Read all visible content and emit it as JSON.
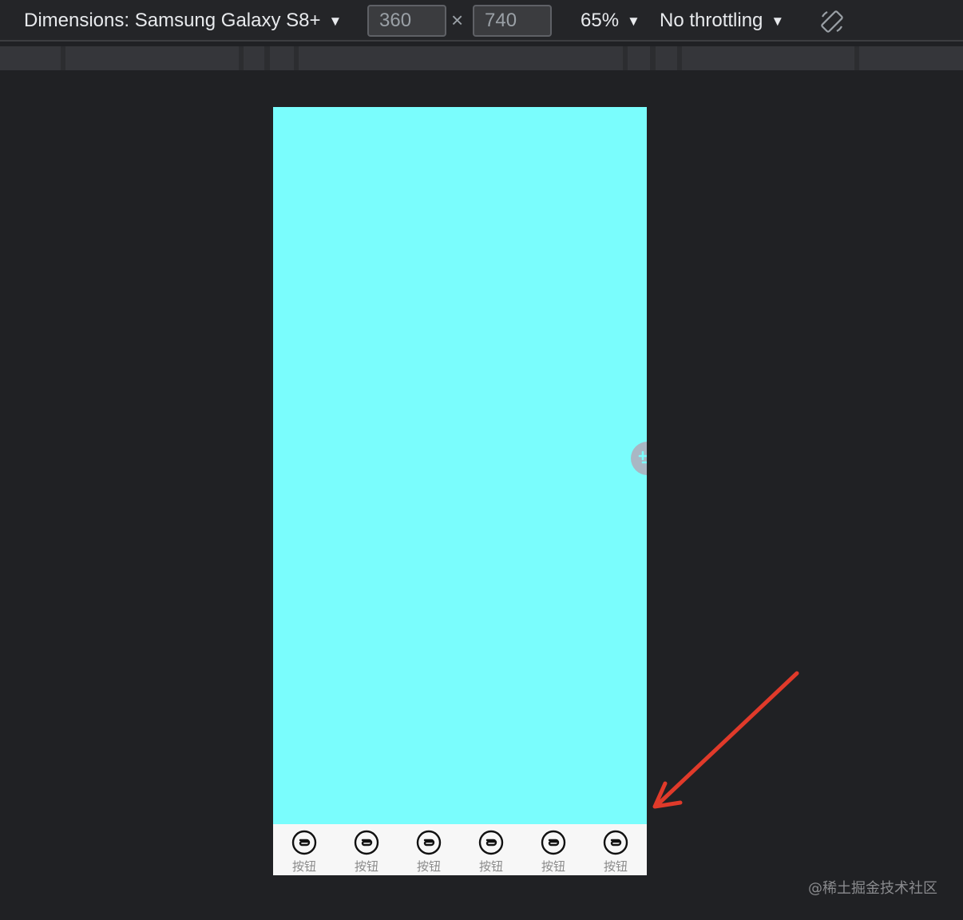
{
  "toolbar": {
    "dimensions_label": "Dimensions: Samsung Galaxy S8+",
    "width_value": "360",
    "times": "×",
    "height_value": "740",
    "zoom": "65%",
    "throttling": "No throttling",
    "caret": "▼"
  },
  "device": {
    "content_color": "#7afdfd",
    "tabs": [
      {
        "label": "按钮"
      },
      {
        "label": "按钮"
      },
      {
        "label": "按钮"
      },
      {
        "label": "按钮"
      },
      {
        "label": "按钮"
      },
      {
        "label": "按钮"
      }
    ]
  },
  "annotation": {
    "arrow_color": "#e03a2a"
  },
  "watermark": "@稀土掘金技术社区"
}
